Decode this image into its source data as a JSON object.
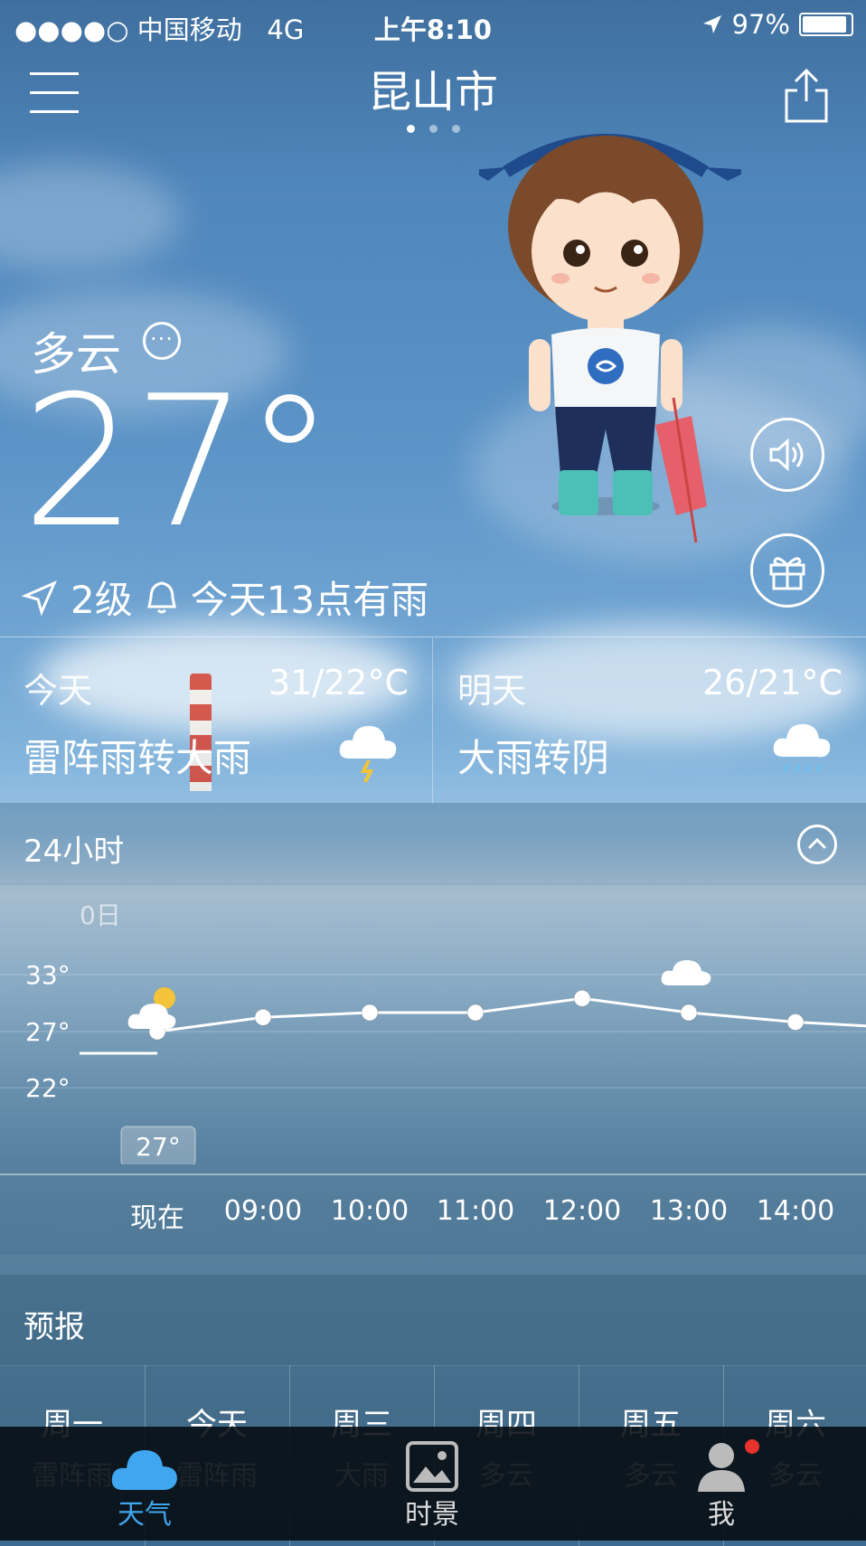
{
  "status_bar": {
    "signal": "●●●●○",
    "carrier": "中国移动",
    "network": "4G",
    "time": "上午8:10",
    "battery": "97%"
  },
  "header": {
    "city": "昆山市",
    "page_dots": 3,
    "active_dot": 0
  },
  "current": {
    "condition": "多云",
    "temperature": "27°",
    "wind": "2级",
    "alert": "今天13点有雨"
  },
  "today": {
    "label": "今天",
    "range": "31/22°C",
    "desc": "雷阵雨转大雨",
    "icon": "thunder-cloud-icon"
  },
  "tomorrow": {
    "label": "明天",
    "range": "26/21°C",
    "desc": "大雨转阴",
    "icon": "rain-cloud-icon"
  },
  "hourly": {
    "title": "24小时",
    "date_marker": "0日",
    "y_ticks": [
      "33°",
      "27°",
      "22°"
    ],
    "current_badge": "27°",
    "times": [
      "现在",
      "09:00",
      "10:00",
      "11:00",
      "12:00",
      "13:00",
      "14:00"
    ],
    "temps": [
      27,
      28.5,
      29,
      29,
      30.5,
      29,
      28
    ]
  },
  "forecast": {
    "title": "预报",
    "days": [
      {
        "day": "周一",
        "cond": "雷阵雨"
      },
      {
        "day": "今天",
        "cond": "雷阵雨"
      },
      {
        "day": "周三",
        "cond": "大雨"
      },
      {
        "day": "周四",
        "cond": "多云"
      },
      {
        "day": "周五",
        "cond": "多云"
      },
      {
        "day": "周六",
        "cond": "多云"
      }
    ]
  },
  "tabbar": {
    "weather": "天气",
    "scenery": "时景",
    "me": "我"
  },
  "colors": {
    "tab_active": "#3fa6ef",
    "badge_red": "#e8322e"
  }
}
